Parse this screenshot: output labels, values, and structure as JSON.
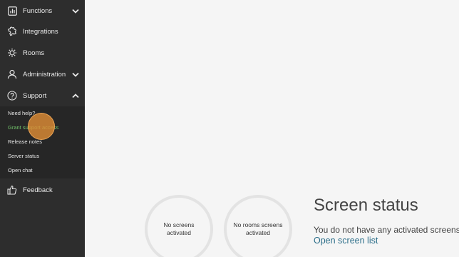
{
  "sidebar": {
    "items": [
      {
        "label": "Functions",
        "icon": "functions-icon",
        "chevron": "down"
      },
      {
        "label": "Integrations",
        "icon": "puzzle-icon"
      },
      {
        "label": "Rooms",
        "icon": "rooms-icon"
      },
      {
        "label": "Administration",
        "icon": "user-icon",
        "chevron": "down"
      },
      {
        "label": "Support",
        "icon": "help-icon",
        "chevron": "up"
      }
    ],
    "support_submenu": [
      {
        "label": "Need help?"
      },
      {
        "label": "Grant support access",
        "active": true
      },
      {
        "label": "Release notes"
      },
      {
        "label": "Server status"
      },
      {
        "label": "Open chat"
      }
    ],
    "feedback": {
      "label": "Feedback",
      "icon": "thumbs-up-icon"
    }
  },
  "main": {
    "circles": [
      {
        "text": "No screens activated"
      },
      {
        "text": "No rooms screens activated"
      }
    ],
    "title": "Screen status",
    "message": "You do not have any activated screens",
    "link": "Open screen list"
  },
  "colors": {
    "sidebar_bg": "#2d2d2d",
    "submenu_bg": "#262626",
    "active_green": "#72c46a",
    "link_blue": "#2d6f8a",
    "click_highlight": "#de8c36"
  }
}
